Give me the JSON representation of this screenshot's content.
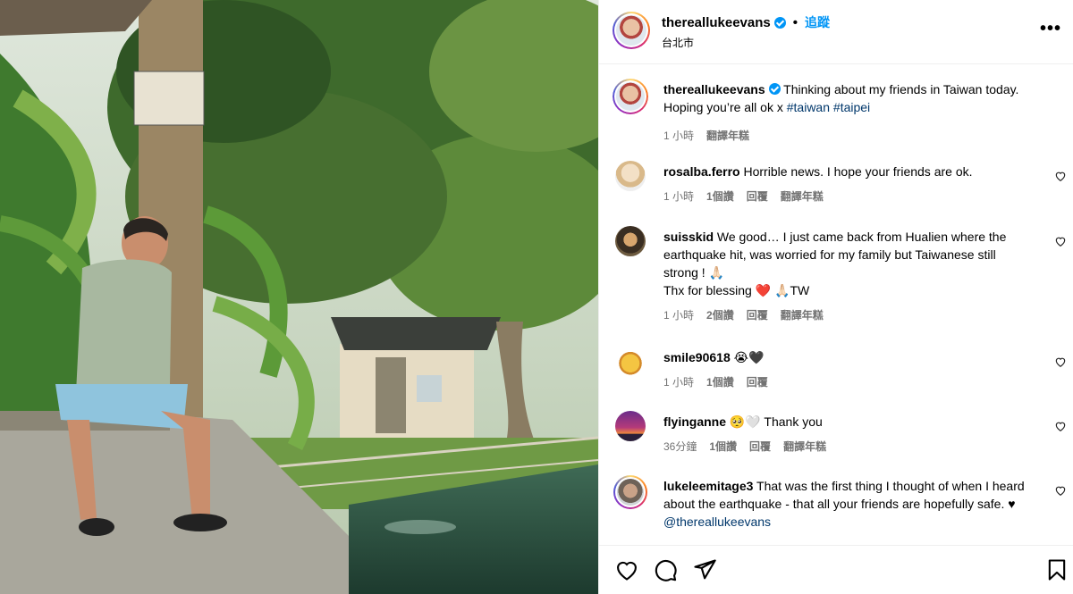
{
  "header": {
    "username": "thereallukeevans",
    "follow_label": "追蹤",
    "location": "台北市",
    "more_label": "•••",
    "dot": "•"
  },
  "caption": {
    "username": "thereallukeevans",
    "text": "Thinking about my friends in Taiwan today. Hoping you’re all ok x",
    "tags": [
      "#taiwan",
      "#taipei"
    ],
    "time": "1 小時",
    "translate": "翻譯年糕"
  },
  "comments": [
    {
      "username": "rosalba.ferro",
      "text": "Horrible news. I hope your friends are ok.",
      "time": "1 小時",
      "likes": "1個讚",
      "reply": "回覆",
      "translate": "翻譯年糕"
    },
    {
      "username": "suisskid",
      "text": "We good… I just came back from Hualien where the earthquake hit, was worried for my family but Taiwanese still strong ! 🙏🏻",
      "text2": "Thx for blessing ❤️ 🙏🏻TW",
      "time": "1 小時",
      "likes": "2個讚",
      "reply": "回覆",
      "translate": "翻譯年糕"
    },
    {
      "username": "smile90618",
      "text": "😭🖤",
      "time": "1 小時",
      "likes": "1個讚",
      "reply": "回覆"
    },
    {
      "username": "flyinganne",
      "text": "🥺🤍 Thank you",
      "time": "36分鐘",
      "likes": "1個讚",
      "reply": "回覆",
      "translate": "翻譯年糕"
    },
    {
      "username": "lukeleemitage3",
      "text": "That was the first thing I thought of when I heard about the earthquake - that all your friends are hopefully safe. ♥",
      "mention": "@thereallukeevans"
    }
  ],
  "colors": {
    "accent": "#0095f6",
    "link": "#00376b",
    "meta": "#737373"
  },
  "icons": {
    "like": "heart-icon",
    "comment": "comment-bubble-icon",
    "share": "paper-plane-icon",
    "save": "bookmark-icon"
  }
}
